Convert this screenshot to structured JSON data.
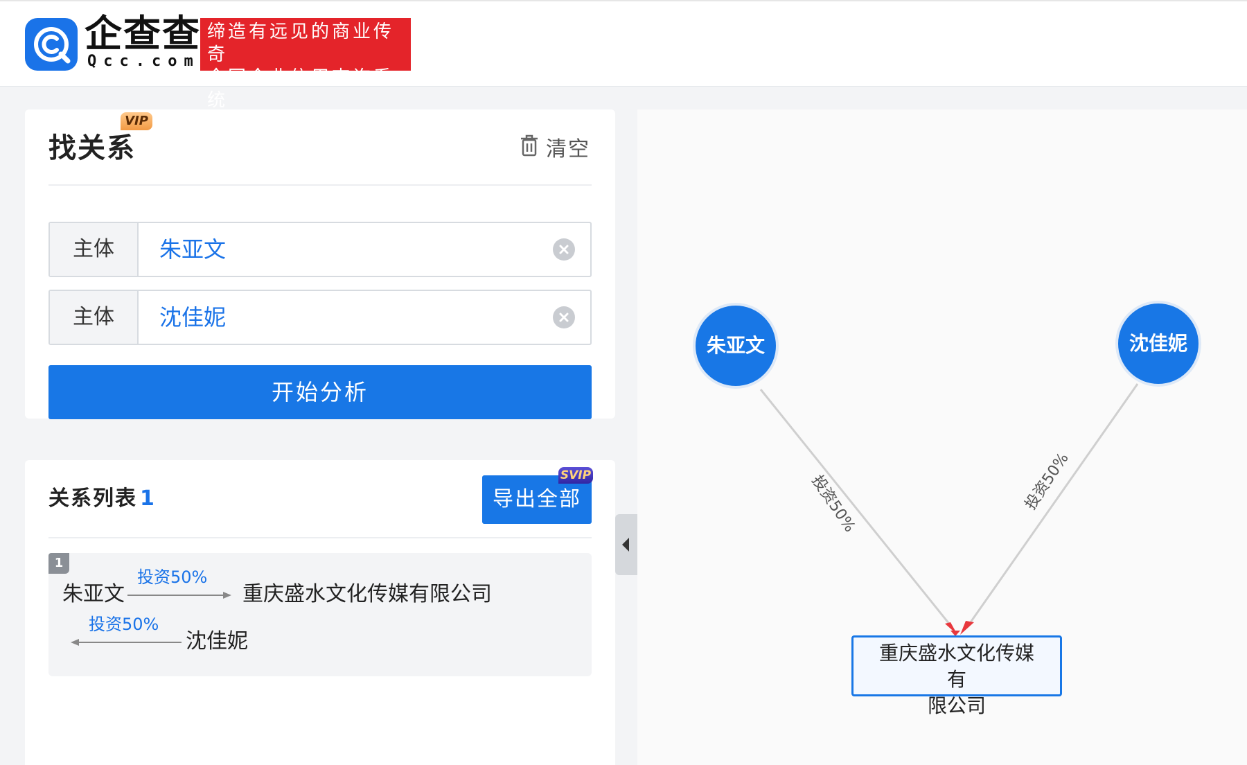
{
  "header": {
    "brand_name": "企查查",
    "brand_domain": "Qcc.com",
    "slogan_line1": "缔造有远见的商业传奇",
    "slogan_line2": "全国企业信用查询系统",
    "logo_icon": "qcc-logo-icon"
  },
  "search_panel": {
    "title": "找关系",
    "vip_badge": "VIP",
    "clear_label": "清空",
    "clear_icon": "trash-icon",
    "fields": [
      {
        "label": "主体",
        "value": "朱亚文"
      },
      {
        "label": "主体",
        "value": "沈佳妮"
      }
    ],
    "analyze_button": "开始分析"
  },
  "relation_list": {
    "title": "关系列表",
    "count": "1",
    "export_button": "导出全部",
    "svip_badge": "SVIP",
    "items": [
      {
        "index": "1",
        "from_person": "朱亚文",
        "edge1_label": "投资50%",
        "company": "重庆盛水文化传媒有限公司",
        "edge2_label": "投资50%",
        "to_person": "沈佳妮"
      }
    ]
  },
  "graph": {
    "node_a": "朱亚文",
    "node_b": "沈佳妮",
    "company_line1": "重庆盛水文化传媒有",
    "company_line2": "限公司",
    "edge_a_label": "投资50%",
    "edge_b_label": "投资50%",
    "person_color": "#1877e6",
    "arrow_color": "#e8383d"
  },
  "colors": {
    "accent": "#1877e6",
    "slogan_bg": "#e4242a",
    "vip_gold": "#f29a44",
    "svip_purple": "#3125a3"
  }
}
